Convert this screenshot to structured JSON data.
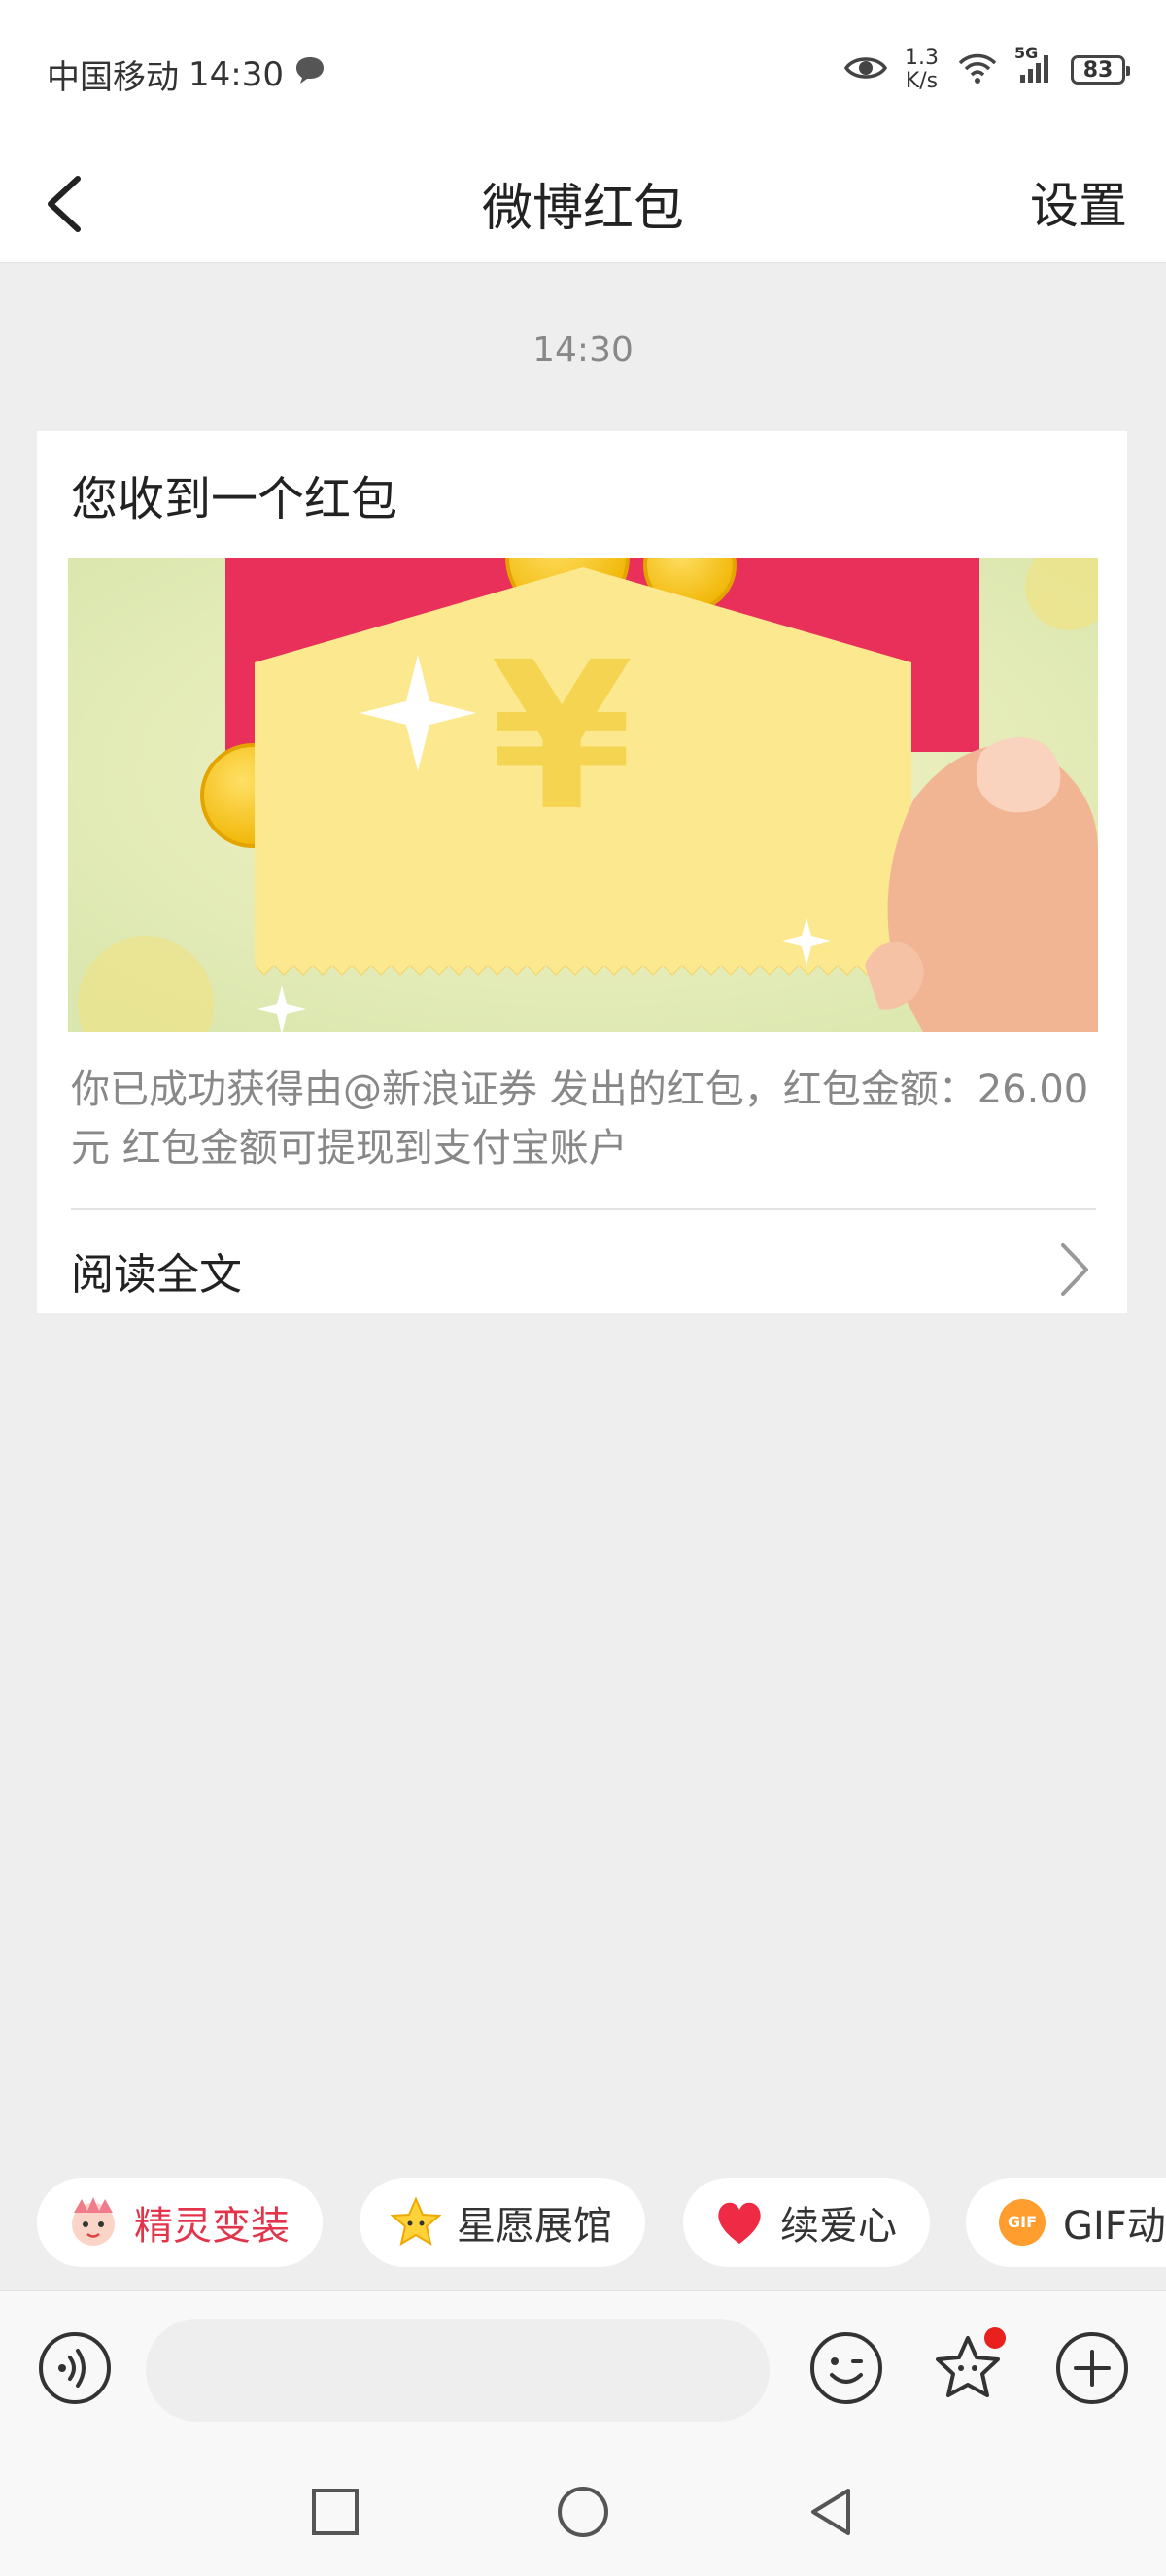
{
  "status_bar": {
    "carrier": "中国移动",
    "time": "14:30",
    "speed_value": "1.3",
    "speed_unit": "K/s",
    "network": "5G",
    "battery": "83"
  },
  "nav": {
    "title": "微博红包",
    "settings_label": "设置"
  },
  "chat": {
    "timestamp": "14:30",
    "card": {
      "title": "您收到一个红包",
      "description": "你已成功获得由@新浪证券 发出的红包，红包金额：26.00元 红包金额可提现到支付宝账户",
      "read_more_label": "阅读全文",
      "banner_symbol": "¥"
    }
  },
  "quick_actions": [
    {
      "label": "精灵变装",
      "icon": "sprite-avatar-icon"
    },
    {
      "label": "星愿展馆",
      "icon": "star-icon"
    },
    {
      "label": "续爱心",
      "icon": "heart-icon"
    },
    {
      "label": "GIF动",
      "icon": "gif-icon",
      "badge": "GIF"
    }
  ],
  "input_bar": {
    "placeholder": "",
    "value": ""
  },
  "colors": {
    "accent_red": "#e2354c",
    "envelope_red": "#e8305a",
    "ticket_yellow": "#fbe88f",
    "banner_green": "#dfe9b6"
  }
}
